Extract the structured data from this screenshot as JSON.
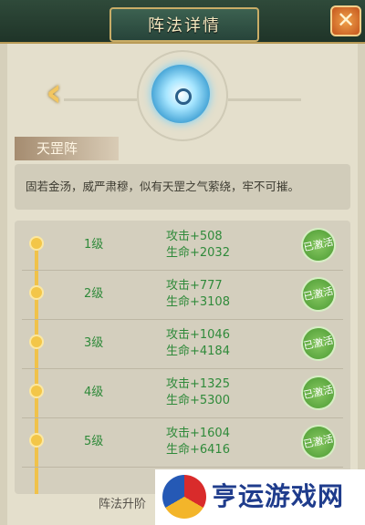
{
  "header": {
    "title": "阵法详情",
    "close_label": "✕"
  },
  "formation": {
    "name": "天罡阵",
    "description": "固若金汤，威严肃穆，似有天罡之气萦绕，牢不可摧。"
  },
  "levels": [
    {
      "level": "1级",
      "attack": "攻击+508",
      "life": "生命+2032",
      "status": "已激活"
    },
    {
      "level": "2级",
      "attack": "攻击+777",
      "life": "生命+3108",
      "status": "已激活"
    },
    {
      "level": "3级",
      "attack": "攻击+1046",
      "life": "生命+4184",
      "status": "已激活"
    },
    {
      "level": "4级",
      "attack": "攻击+1325",
      "life": "生命+5300",
      "status": "已激活"
    },
    {
      "level": "5级",
      "attack": "攻击+1604",
      "life": "生命+6416",
      "status": "已激活"
    }
  ],
  "footer": {
    "upgrade_text": "阵法升阶"
  },
  "watermark": {
    "text": "亨运游戏网"
  },
  "colors": {
    "accent": "#2f8a3a",
    "timeline": "#f0c24a",
    "title_bg": "#2f4a3a"
  }
}
